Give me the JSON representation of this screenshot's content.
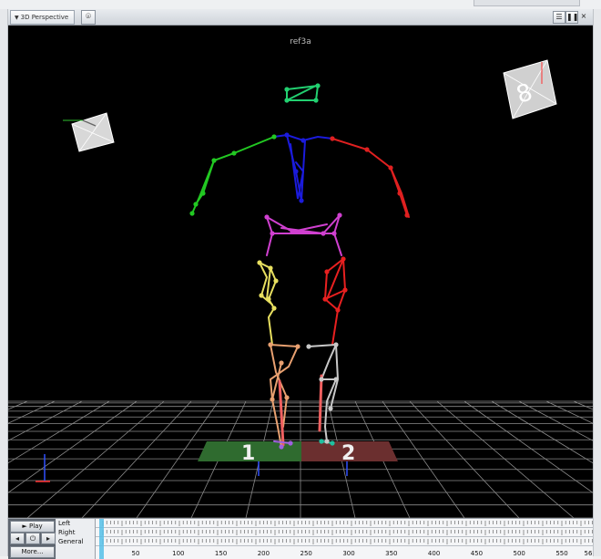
{
  "viewport": {
    "tab_label": "3D Perspective",
    "camera_icon": "camera-icon",
    "take_name": "ref3a",
    "floor_markers": [
      "1",
      "2"
    ],
    "cube_label": "8"
  },
  "header_buttons": [
    "layout-grid-icon",
    "pause-icon",
    "close-icon"
  ],
  "timeline": {
    "play_label": "► Play",
    "more_label": "More...",
    "tracks": [
      "Left",
      "Right",
      "General"
    ],
    "ruler": [
      "50",
      "100",
      "150",
      "200",
      "250",
      "300",
      "350",
      "400",
      "450",
      "500",
      "550",
      "56"
    ]
  },
  "colors": {
    "left_arm": "#22c822",
    "right_arm": "#e02020",
    "spine": "#1b1bdc",
    "head": "#22d070",
    "pelvis": "#d040d0",
    "left_thigh": "#e8e060",
    "right_thigh": "#e82020",
    "left_shin": "#e8a070",
    "right_shin": "#c8c8c8",
    "floor_green": "#2f6b2f",
    "floor_red": "#6b2f2f",
    "grid": "#8a8a8a"
  }
}
